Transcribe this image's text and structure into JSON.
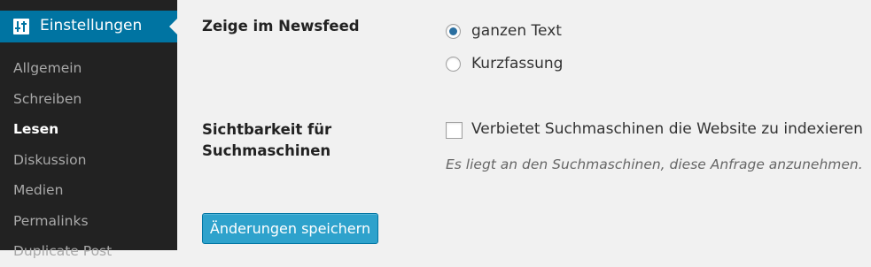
{
  "sidebar": {
    "menu": {
      "label": "Einstellungen",
      "icon": "settings-sliders-icon"
    },
    "items": [
      {
        "label": "Allgemein"
      },
      {
        "label": "Schreiben"
      },
      {
        "label": "Lesen",
        "current": true
      },
      {
        "label": "Diskussion"
      },
      {
        "label": "Medien"
      },
      {
        "label": "Permalinks"
      },
      {
        "label": "Duplicate Post"
      }
    ]
  },
  "settings": {
    "newsfeed": {
      "label": "Zeige im Newsfeed",
      "options": [
        {
          "label": "ganzen Text",
          "selected": true
        },
        {
          "label": "Kurzfassung",
          "selected": false
        }
      ]
    },
    "visibility": {
      "label_line1": "Sichtbarkeit für",
      "label_line2": "Suchmaschinen",
      "checkbox_label": "Verbietet Suchmaschinen die Website zu indexieren",
      "checked": false,
      "hint": "Es liegt an den Suchmaschinen, diese Anfrage anzunehmen."
    }
  },
  "buttons": {
    "save": "Änderungen speichern"
  },
  "colors": {
    "sidebar_bg": "#222222",
    "accent": "#0074a2",
    "button": "#2ea2cc",
    "page_bg": "#f1f1f1"
  }
}
